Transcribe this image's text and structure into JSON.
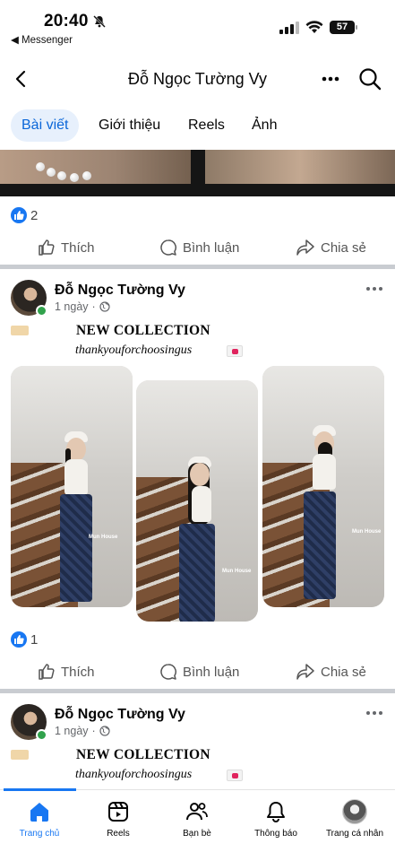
{
  "status_bar": {
    "time": "20:40",
    "back_app": "◀ Messenger",
    "battery": "57"
  },
  "header": {
    "title": "Đỗ Ngọc Tường Vy"
  },
  "tabs": [
    {
      "label": "Bài viết",
      "active": true
    },
    {
      "label": "Giới thiệu",
      "active": false
    },
    {
      "label": "Reels",
      "active": false
    },
    {
      "label": "Ảnh",
      "active": false
    }
  ],
  "actions": {
    "like": "Thích",
    "comment": "Bình luận",
    "share": "Chia sẻ"
  },
  "posts": [
    {
      "reaction_count": "2"
    },
    {
      "author": "Đỗ Ngọc Tường Vy",
      "time": "1 ngày",
      "separator": "·",
      "headline": "NEW COLLECTION",
      "subline": "thankyouforchoosingus",
      "watermark": "Mun House",
      "reaction_count": "1"
    },
    {
      "author": "Đỗ Ngọc Tường Vy",
      "time": "1 ngày",
      "separator": "·",
      "headline": "NEW COLLECTION",
      "subline": "thankyouforchoosingus"
    }
  ],
  "bottom_nav": [
    {
      "label": "Trang chủ",
      "icon": "home-icon",
      "active": true
    },
    {
      "label": "Reels",
      "icon": "reels-icon",
      "active": false
    },
    {
      "label": "Bạn bè",
      "icon": "friends-icon",
      "active": false
    },
    {
      "label": "Thông báo",
      "icon": "bell-icon",
      "active": false
    },
    {
      "label": "Trang cá nhân",
      "icon": "profile-icon",
      "active": false
    }
  ],
  "colors": {
    "accent": "#1877f2",
    "tab_active_bg": "#e7f0fc",
    "online": "#31a24c"
  }
}
